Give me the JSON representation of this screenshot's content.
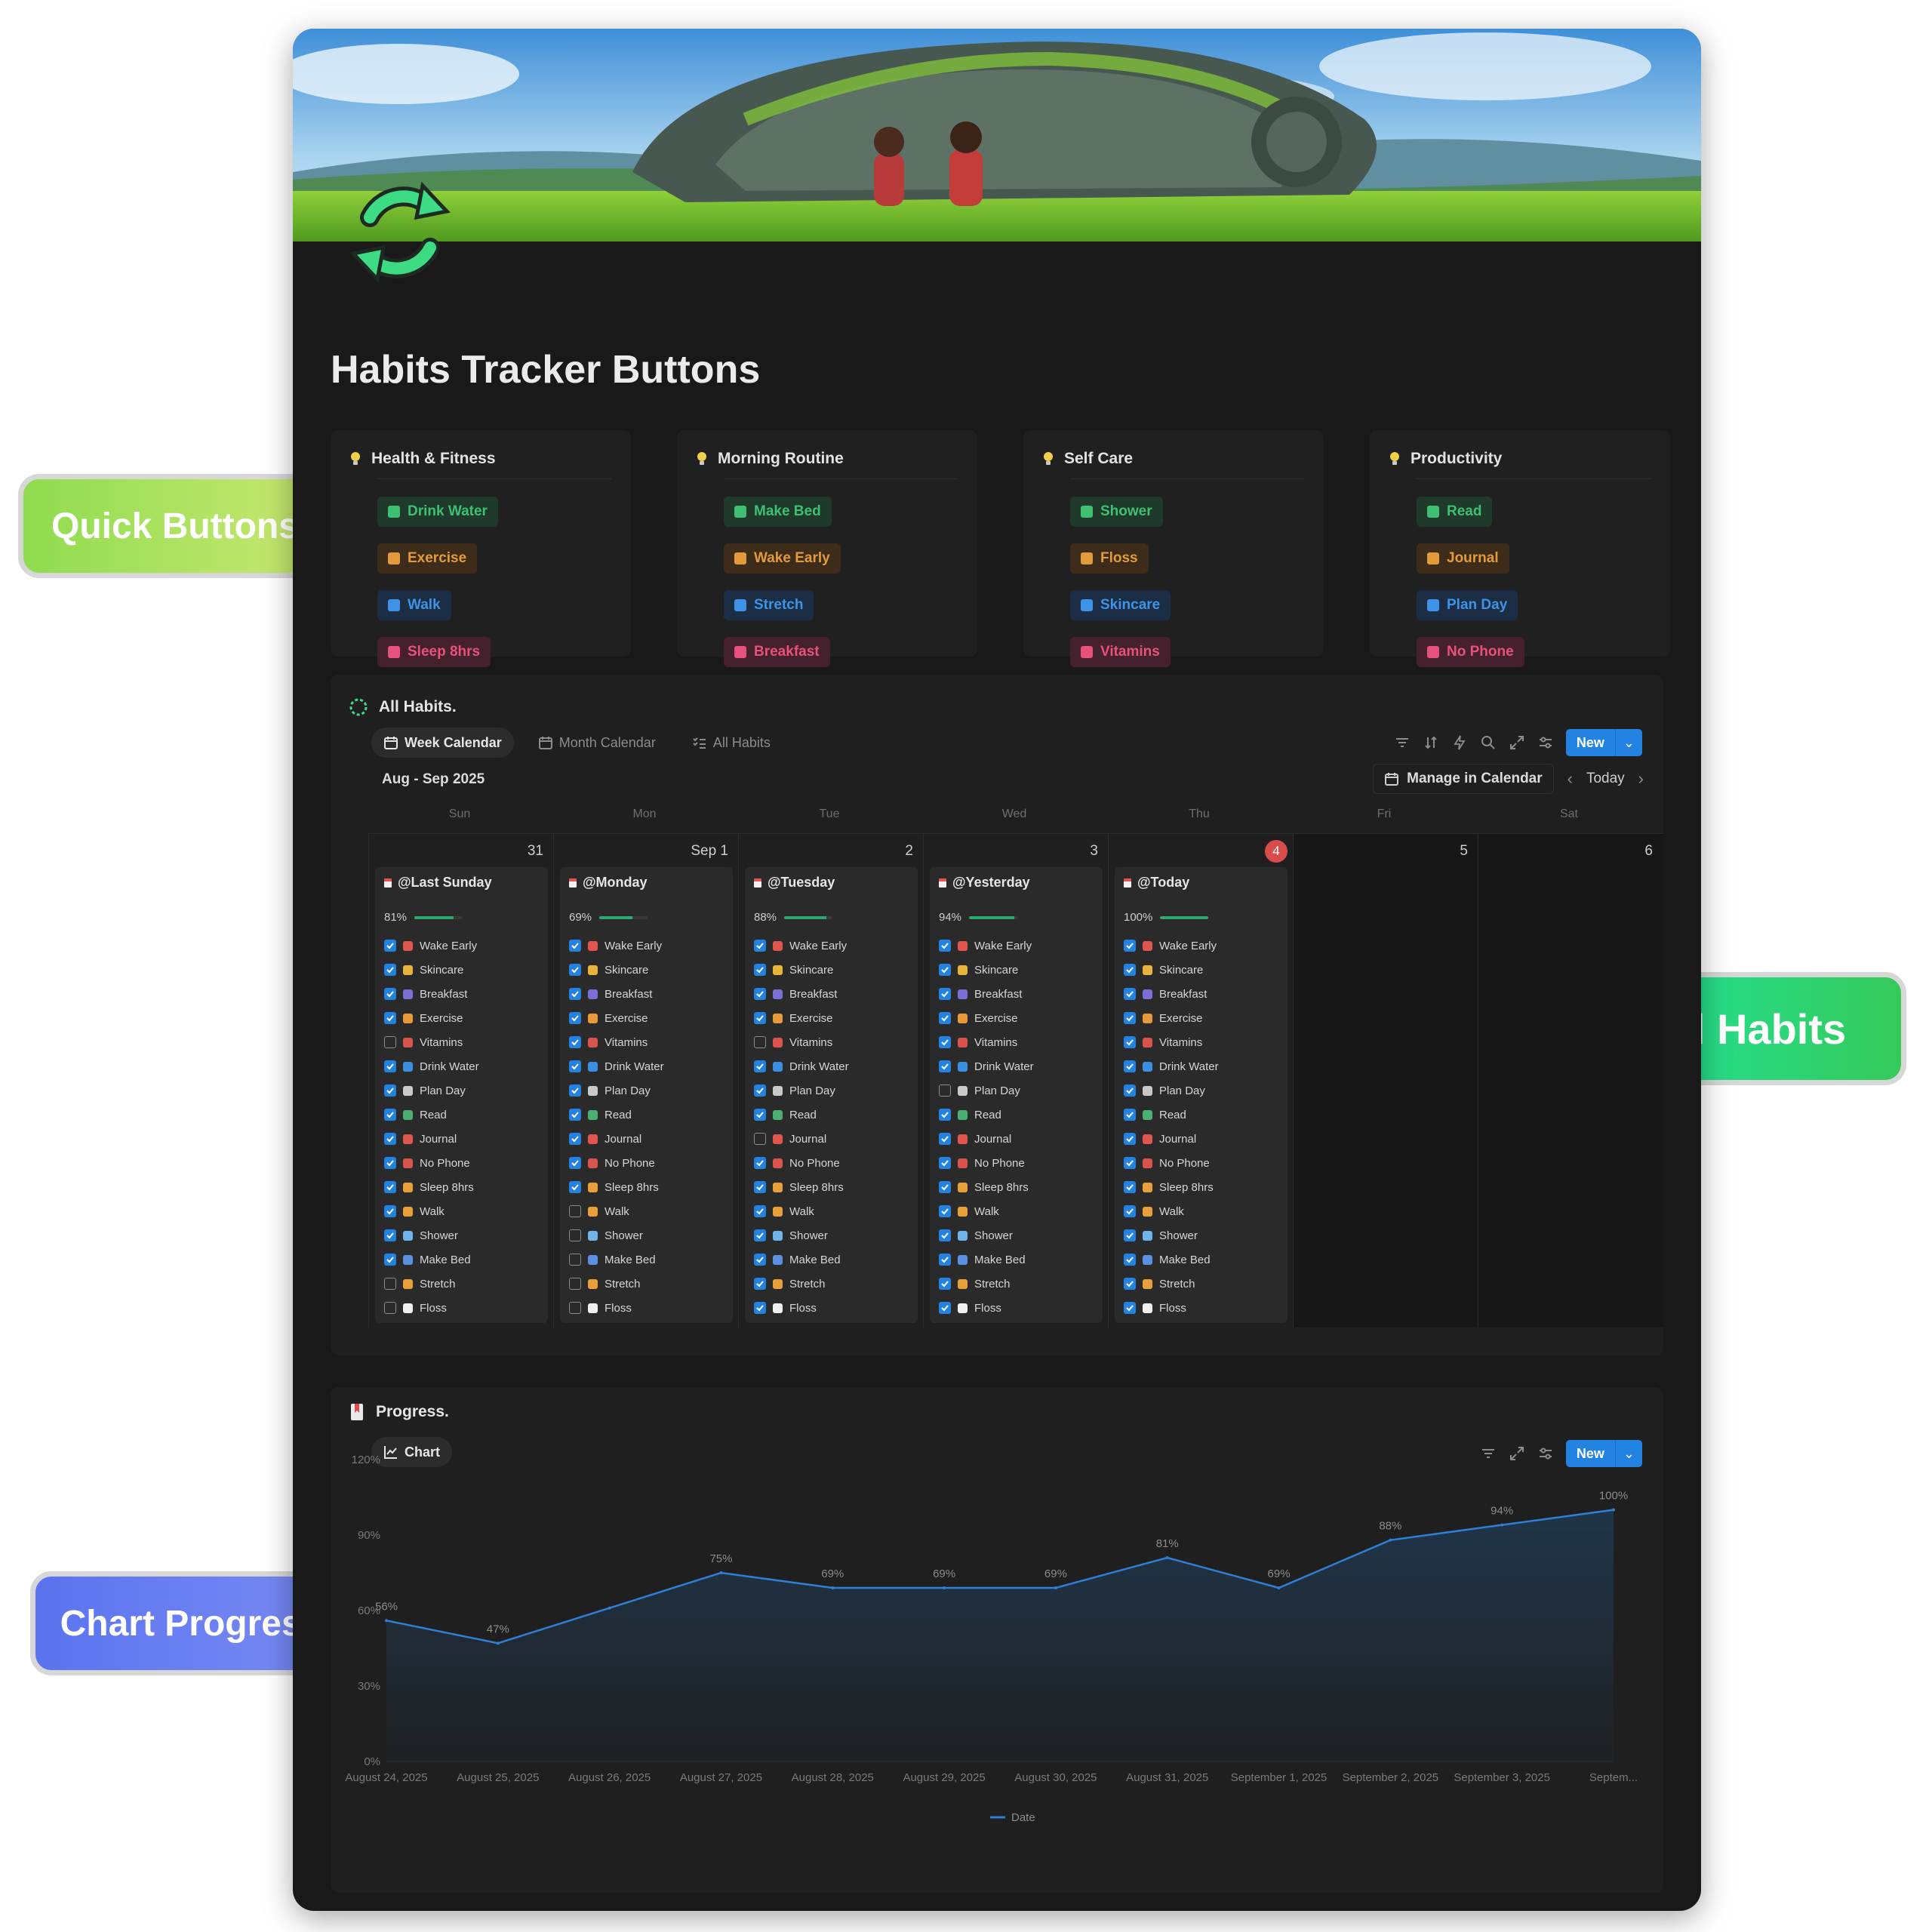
{
  "page_title": "Habits Tracker Buttons",
  "callouts": {
    "quick_buttons": "Quick Buttons",
    "all_habits": "All Habits",
    "chart_progress": "Chart Progress"
  },
  "colors": {
    "page_bg": "#191919",
    "accent_blue": "#2383e2",
    "progress_green": "#2fa86f",
    "today_red": "#d94c4c"
  },
  "categories": [
    {
      "title": "Health & Fitness",
      "buttons": [
        {
          "label": "Drink Water",
          "icon": "water-drop-icon",
          "tone": "green"
        },
        {
          "label": "Exercise",
          "icon": "dumbbell-icon",
          "tone": "brown"
        },
        {
          "label": "Walk",
          "icon": "walking-person-icon",
          "tone": "blue"
        },
        {
          "label": "Sleep 8hrs",
          "icon": "bed-icon",
          "tone": "pink"
        }
      ]
    },
    {
      "title": "Morning Routine",
      "buttons": [
        {
          "label": "Make Bed",
          "icon": "bed-icon",
          "tone": "green"
        },
        {
          "label": "Wake Early",
          "icon": "sunrise-icon",
          "tone": "brown"
        },
        {
          "label": "Stretch",
          "icon": "stretch-person-icon",
          "tone": "blue"
        },
        {
          "label": "Breakfast",
          "icon": "food-icon",
          "tone": "pink"
        }
      ]
    },
    {
      "title": "Self Care",
      "buttons": [
        {
          "label": "Shower",
          "icon": "shower-icon",
          "tone": "green"
        },
        {
          "label": "Floss",
          "icon": "tooth-icon",
          "tone": "brown"
        },
        {
          "label": "Skincare",
          "icon": "face-icon",
          "tone": "blue"
        },
        {
          "label": "Vitamins",
          "icon": "pill-icon",
          "tone": "pink"
        }
      ]
    },
    {
      "title": "Productivity",
      "buttons": [
        {
          "label": "Read",
          "icon": "book-icon",
          "tone": "green"
        },
        {
          "label": "Journal",
          "icon": "pen-icon",
          "tone": "brown"
        },
        {
          "label": "Plan Day",
          "icon": "edit-icon",
          "tone": "blue"
        },
        {
          "label": "No Phone",
          "icon": "phone-icon",
          "tone": "pink"
        }
      ]
    }
  ],
  "all_habits": {
    "title": "All Habits.",
    "tabs": [
      {
        "label": "Week Calendar",
        "icon": "calendar-icon",
        "active": true
      },
      {
        "label": "Month Calendar",
        "icon": "calendar-icon",
        "active": false
      },
      {
        "label": "All Habits",
        "icon": "checklist-icon",
        "active": false
      }
    ],
    "new_label": "New",
    "date_range": "Aug - Sep 2025",
    "manage_label": "Manage in Calendar",
    "today_label": "Today",
    "weekdays": [
      "Sun",
      "Mon",
      "Tue",
      "Wed",
      "Thu",
      "Fri",
      "Sat"
    ],
    "day_numbers": [
      "31",
      "Sep 1",
      "2",
      "3",
      "4",
      "5",
      "6"
    ],
    "today_index": 4,
    "habit_order": [
      "Wake Early",
      "Skincare",
      "Breakfast",
      "Exercise",
      "Vitamins",
      "Drink Water",
      "Plan Day",
      "Read",
      "Journal",
      "No Phone",
      "Sleep 8hrs",
      "Walk",
      "Shower",
      "Make Bed",
      "Stretch",
      "Floss"
    ],
    "habit_icon_colors": [
      "#e0564f",
      "#e8b43a",
      "#7b6fd6",
      "#e89a3a",
      "#d9534f",
      "#3b8fe0",
      "#c9c9c9",
      "#4caf72",
      "#e0564f",
      "#d9534f",
      "#e8a03a",
      "#e8a03a",
      "#6fb3e8",
      "#5b8fe0",
      "#e8a03a",
      "#f0f0f0"
    ],
    "days": [
      {
        "title": "@Last Sunday",
        "percent": "81%",
        "fraction": 0.81,
        "checks": [
          true,
          true,
          true,
          true,
          false,
          true,
          true,
          true,
          true,
          true,
          true,
          true,
          true,
          true,
          false,
          false
        ]
      },
      {
        "title": "@Monday",
        "percent": "69%",
        "fraction": 0.69,
        "checks": [
          true,
          true,
          true,
          true,
          true,
          true,
          true,
          true,
          true,
          true,
          true,
          false,
          false,
          false,
          false,
          false
        ]
      },
      {
        "title": "@Tuesday",
        "percent": "88%",
        "fraction": 0.88,
        "checks": [
          true,
          true,
          true,
          true,
          false,
          true,
          true,
          true,
          false,
          true,
          true,
          true,
          true,
          true,
          true,
          true
        ]
      },
      {
        "title": "@Yesterday",
        "percent": "94%",
        "fraction": 0.94,
        "checks": [
          true,
          true,
          true,
          true,
          true,
          true,
          false,
          true,
          true,
          true,
          true,
          true,
          true,
          true,
          true,
          true
        ]
      },
      {
        "title": "@Today",
        "percent": "100%",
        "fraction": 1.0,
        "checks": [
          true,
          true,
          true,
          true,
          true,
          true,
          true,
          true,
          true,
          true,
          true,
          true,
          true,
          true,
          true,
          true
        ]
      }
    ]
  },
  "progress": {
    "title": "Progress.",
    "tab_label": "Chart",
    "new_label": "New"
  },
  "chart_data": {
    "type": "area",
    "x": [
      "August 24, 2025",
      "August 25, 2025",
      "August 26, 2025",
      "August 27, 2025",
      "August 28, 2025",
      "August 29, 2025",
      "August 30, 2025",
      "August 31, 2025",
      "September 1, 2025",
      "September 2, 2025",
      "September 3, 2025",
      "Septem..."
    ],
    "series": [
      {
        "name": "Date",
        "values": [
          56,
          47,
          61,
          75,
          69,
          69,
          69,
          81,
          69,
          88,
          94,
          100
        ]
      }
    ],
    "value_labels": [
      "56%",
      "47%",
      "",
      "75%",
      "69%",
      "69%",
      "69%",
      "81%",
      "69%",
      "88%",
      "94%",
      "100%"
    ],
    "y_ticks": [
      "0%",
      "30%",
      "60%",
      "90%",
      "120%"
    ],
    "ylim": [
      0,
      120
    ],
    "legend": "bottom",
    "grid": false
  }
}
